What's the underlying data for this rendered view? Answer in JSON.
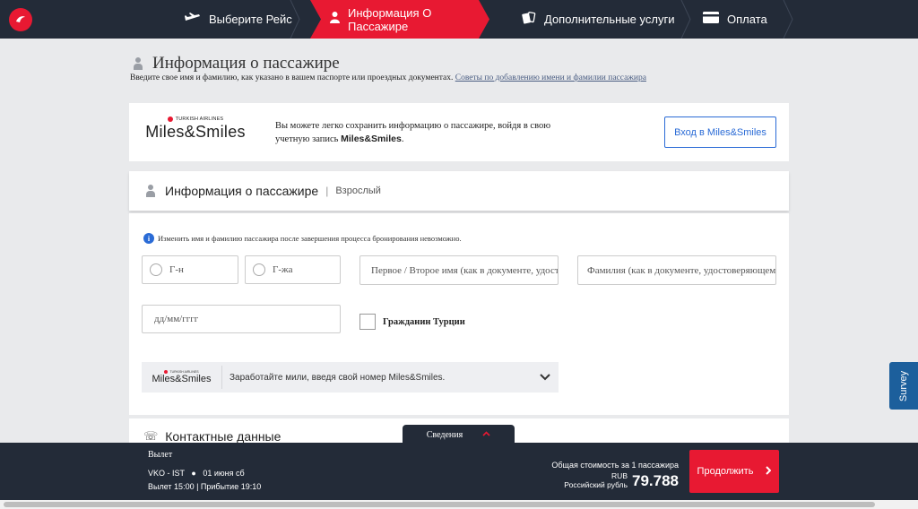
{
  "nav": {
    "steps": [
      {
        "label": "Выберите Рейс",
        "icon": "plane-icon"
      },
      {
        "label": "Информация О Пассажире",
        "icon": "person-icon",
        "active": true
      },
      {
        "label": "Дополнительные услуги",
        "icon": "extras-icon"
      },
      {
        "label": "Оплата",
        "icon": "card-icon"
      }
    ],
    "accent_color": "#e81932",
    "bg_color": "#232b38"
  },
  "page": {
    "title": "Информация о пассажире",
    "subtitle": "Введите свое имя и фамилию, как указано в вашем паспорте или проездных документах.",
    "subtitle_link": "Советы по добавлению имени и фамилии пассажира"
  },
  "ms_card": {
    "airline": "TURKISH AIRLINES",
    "brand": "Miles&Smiles",
    "text_prefix": "Вы можете легко сохранить информацию о пассажире, войдя в свою учетную запись ",
    "text_brand": "Miles&Smiles",
    "text_suffix": ".",
    "login_button": "Вход в Miles&Smiles"
  },
  "passenger": {
    "section_title": "Информация о пассажире",
    "passenger_type": "Взрослый",
    "notice": "Изменить имя и фамилию пассажира после завершения процесса бронирования невозможно.",
    "title_mr": "Г-н",
    "title_ms": "Г-жа",
    "first_name_placeholder": "Первое / Второе имя (как в документе, удостоверяющем личность)",
    "last_name_placeholder": "Фамилия (как в документе, удостоверяющем личность)",
    "date_placeholder": "дд/мм/гггг",
    "turkish_citizen_label": "Гражданин Турции",
    "ms_earn_airline": "TURKISH AIRLINES",
    "ms_earn_brand": "Miles&Smiles",
    "ms_earn_text": "Заработайте мили, введя свой номер Miles&Smiles."
  },
  "contact": {
    "title": "Контактные данные"
  },
  "details_tab": "Сведения",
  "bottom": {
    "departure_title": "Вылет",
    "route": "VKO - IST",
    "date": "01 июня сб",
    "times": "Вылет 15:00 | Прибытие 19:10",
    "total_label": "Общая стоимость за 1 пассажира",
    "currency_code": "RUB",
    "currency_name": "Российский рубль",
    "amount": "79.788",
    "continue_button": "Продолжить"
  },
  "survey": "Survey"
}
